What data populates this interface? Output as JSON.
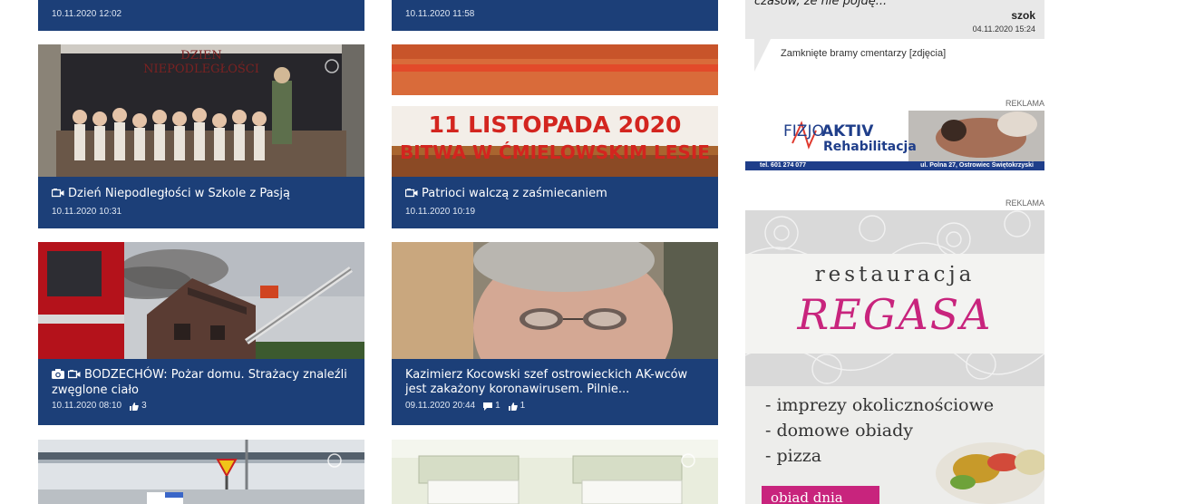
{
  "cards": [
    {
      "title": "",
      "date": "10.11.2020 12:02"
    },
    {
      "title": "",
      "date": "10.11.2020 11:58"
    },
    {
      "title": "Dzień Niepodległości w Szkole z Pasją",
      "date": "10.11.2020 10:31",
      "icons": [
        "video-icon"
      ],
      "img_text": [
        "DZIEN",
        "NIEPODLEGŁOŚCI"
      ]
    },
    {
      "title": "Patrioci walczą z zaśmiecaniem",
      "date": "10.11.2020 10:19",
      "icons": [
        "video-icon"
      ],
      "img_text": [
        "11 LISTOPADA 2020",
        "BITWA W ĆMIELOWSKIM LESIE"
      ]
    },
    {
      "title": "BODZECHÓW: Pożar domu. Strażacy znaleźli zwęglone ciało",
      "date": "10.11.2020 08:10",
      "icons": [
        "camera-icon",
        "video-icon"
      ],
      "likes": "3"
    },
    {
      "title": "Kazimierz Kocowski szef ostrowieckich AK-wców jest zakażony koronawirusem. Pilnie...",
      "date": "09.11.2020 20:44",
      "comments": "1",
      "likes": "1"
    },
    {
      "title": "",
      "date": ""
    },
    {
      "title": "",
      "date": ""
    }
  ],
  "sidebar": {
    "comment": {
      "text": "czasów, że nie pojdę...",
      "author": "szok",
      "date": "04.11.2020 15:24",
      "article": "Zamknięte bramy cmentarzy [zdjęcia]"
    },
    "ad1": {
      "label": "REKLAMA",
      "brand_a": "FIZJO",
      "brand_b": "AKTIV",
      "brand_c": "Rehabilitacja",
      "phone": "tel. 601 274 077",
      "address": "ul. Polna 27, Ostrowiec Świętokrzyski"
    },
    "ad2": {
      "label": "REKLAMA",
      "line1": "restauracja",
      "line2": "REGASA",
      "bullets": [
        "- imprezy okolicznościowe",
        "- domowe obiady",
        "- pizza"
      ],
      "cta": "obiad dnia"
    }
  },
  "colors": {
    "caption_bg": "#1c3f78",
    "regasa_pink": "#c8247d",
    "fizjo_blue": "#1f3e8a"
  }
}
